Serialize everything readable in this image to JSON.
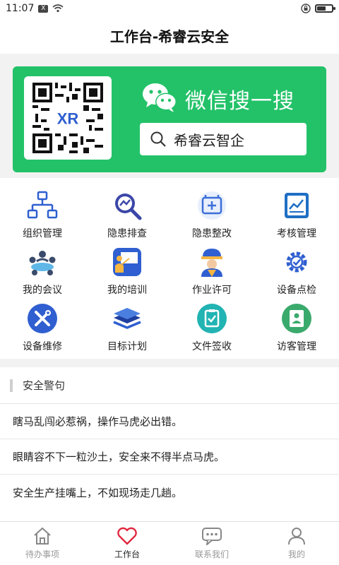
{
  "status_bar": {
    "time": "11:07",
    "x_badge": "X",
    "battery_level": 0.6
  },
  "header": {
    "title": "工作台-希睿云安全"
  },
  "banner": {
    "wechat_title": "微信搜一搜",
    "search_text": "希睿云智企",
    "qr_logo_text": "XR"
  },
  "grid": {
    "items": [
      {
        "label": "组织管理",
        "icon": "org-chart-icon"
      },
      {
        "label": "隐患排查",
        "icon": "hazard-inspect-icon"
      },
      {
        "label": "隐患整改",
        "icon": "hazard-fix-icon"
      },
      {
        "label": "考核管理",
        "icon": "assessment-icon"
      },
      {
        "label": "我的会议",
        "icon": "meeting-icon"
      },
      {
        "label": "我的培训",
        "icon": "training-icon"
      },
      {
        "label": "作业许可",
        "icon": "work-permit-icon"
      },
      {
        "label": "设备点检",
        "icon": "equipment-check-icon"
      },
      {
        "label": "设备维修",
        "icon": "repair-icon"
      },
      {
        "label": "目标计划",
        "icon": "target-plan-icon"
      },
      {
        "label": "文件签收",
        "icon": "file-sign-icon"
      },
      {
        "label": "访客管理",
        "icon": "visitor-icon"
      }
    ]
  },
  "warnings": {
    "title": "安全警句",
    "items": [
      "瞎马乱闯必惹祸，操作马虎必出错。",
      "眼睛容不下一粒沙土，安全来不得半点马虎。",
      "安全生产挂嘴上，不如现场走几趟。"
    ]
  },
  "tabbar": {
    "tabs": [
      {
        "label": "待办事项",
        "icon": "home-icon"
      },
      {
        "label": "工作台",
        "icon": "heart-icon"
      },
      {
        "label": "联系我们",
        "icon": "chat-icon"
      },
      {
        "label": "我的",
        "icon": "user-icon"
      }
    ],
    "active_index": 1
  },
  "colors": {
    "wechat_green": "#23c268",
    "active_heart": "#e0283f",
    "icon_blue": "#2f5fd0"
  }
}
